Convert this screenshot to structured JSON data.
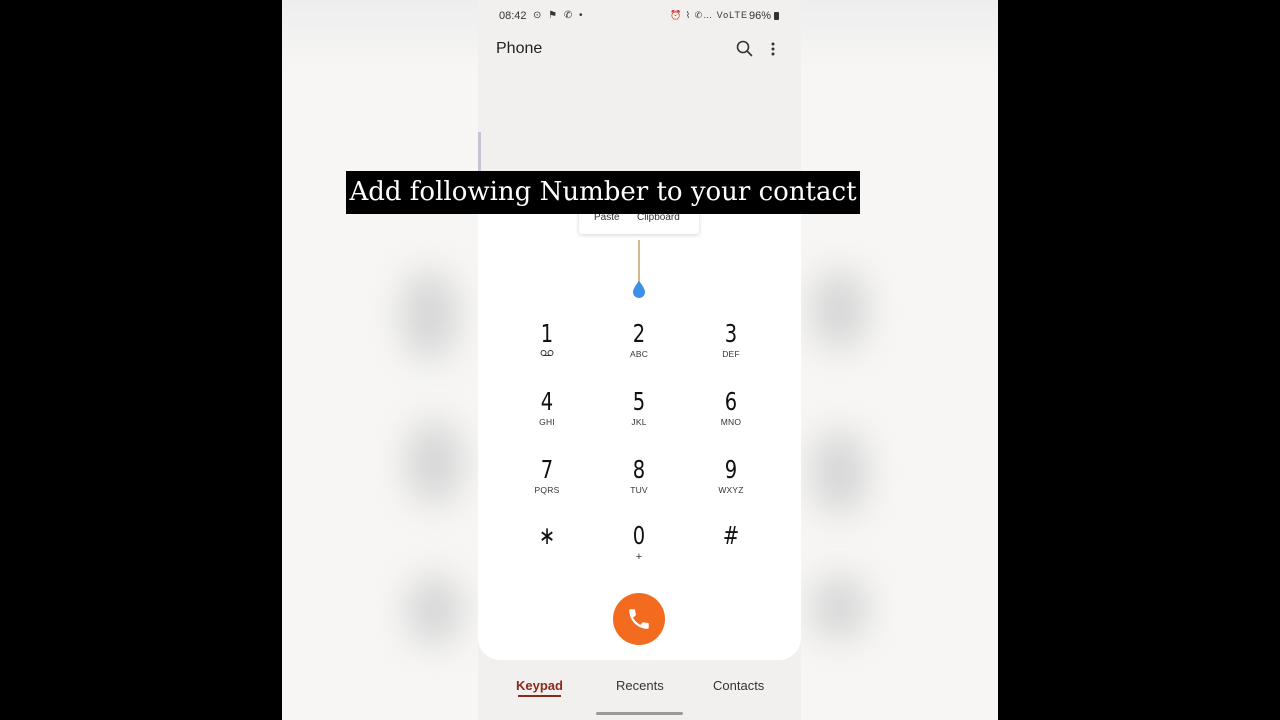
{
  "status_bar": {
    "time": "08:42",
    "left_icons": "⊙ ⚑ ✆ •",
    "right_icons": "⏰ ⌇ ✆… VoLTE",
    "battery": "96%"
  },
  "app": {
    "title": "Phone",
    "search_icon": "search-icon",
    "more_icon": "more-vert-icon"
  },
  "clipboard_menu": {
    "paste": "Paste",
    "clipboard": "Clipboard"
  },
  "caption": "Add following Number to your contact",
  "keypad": [
    {
      "digit": "1",
      "letters": ""
    },
    {
      "digit": "2",
      "letters": "ABC"
    },
    {
      "digit": "3",
      "letters": "DEF"
    },
    {
      "digit": "4",
      "letters": "GHI"
    },
    {
      "digit": "5",
      "letters": "JKL"
    },
    {
      "digit": "6",
      "letters": "MNO"
    },
    {
      "digit": "7",
      "letters": "PQRS"
    },
    {
      "digit": "8",
      "letters": "TUV"
    },
    {
      "digit": "9",
      "letters": "WXYZ"
    },
    {
      "digit": "∗",
      "letters": ""
    },
    {
      "digit": "0",
      "letters": "+"
    },
    {
      "digit": "#",
      "letters": ""
    }
  ],
  "call_button": "phone-call-icon",
  "nav": {
    "keypad": "Keypad",
    "recents": "Recents",
    "contacts": "Contacts",
    "active_color": "#8a2a1a"
  },
  "colors": {
    "call": "#f26b1f",
    "cursor_handle": "#3d8fe8"
  }
}
